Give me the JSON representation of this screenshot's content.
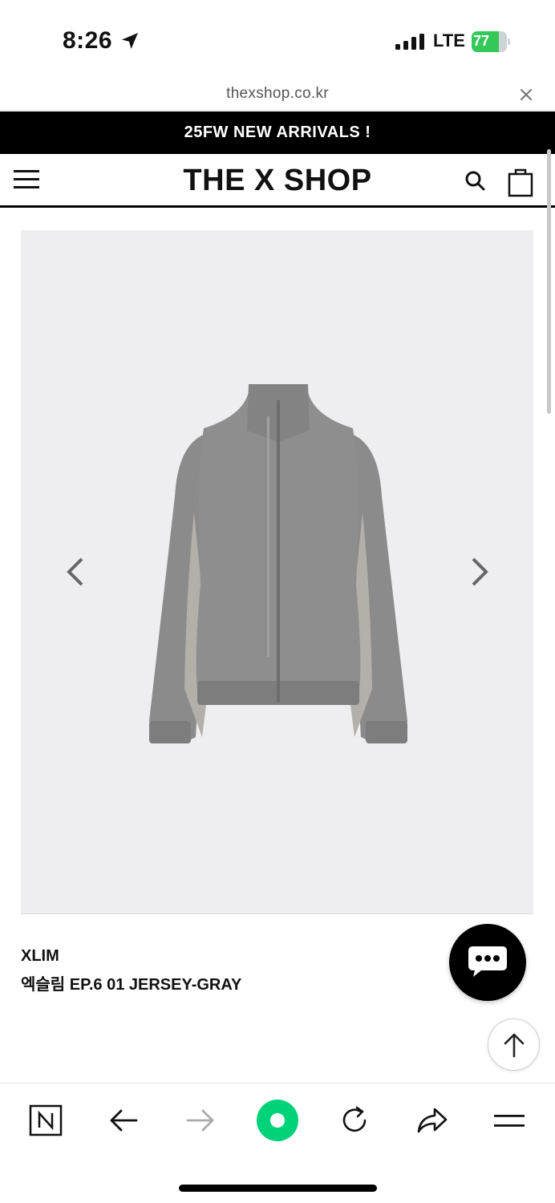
{
  "status_bar": {
    "time": "8:26",
    "network": "LTE",
    "battery_level": "77",
    "battery_fraction": 0.77,
    "battery_color": "#34c759"
  },
  "browser": {
    "url": "thexshop.co.kr",
    "toolbar_icons": [
      "naver-icon",
      "back-arrow-icon",
      "forward-arrow-icon",
      "green-dot-icon",
      "reload-icon",
      "share-icon",
      "menu-icon"
    ],
    "accent_color": "#00d27a"
  },
  "promo_banner": {
    "text": "25FW NEW ARRIVALS !"
  },
  "header": {
    "logo": "THE X SHOP"
  },
  "product": {
    "image_bg": "#eeeef0",
    "brand": "XLIM",
    "name": "엑슬림 EP.6 01 JERSEY-GRAY"
  }
}
